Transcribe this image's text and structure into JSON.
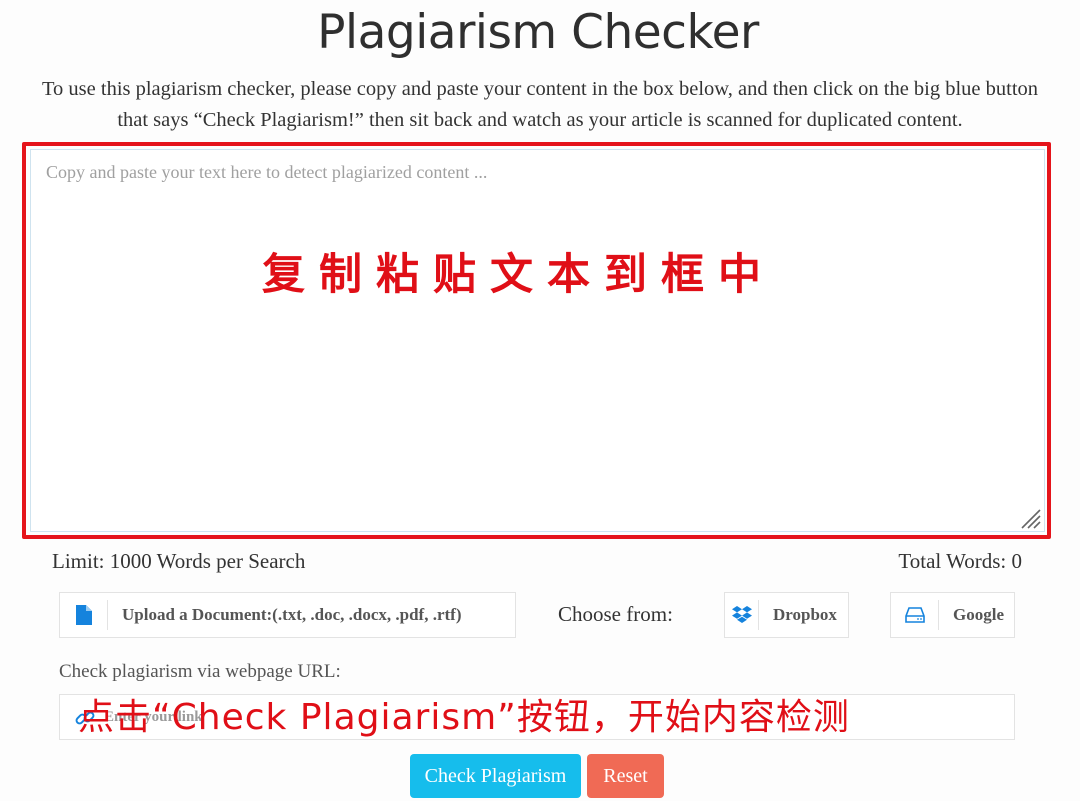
{
  "header": {
    "title": "Plagiarism Checker",
    "intro_line1": "To use this plagiarism checker, please copy and paste your content in the box below, and then click on the big blue button",
    "intro_line2": "that says “Check Plagiarism!” then sit back and watch as your article is scanned for duplicated content."
  },
  "editor": {
    "value": "",
    "placeholder": "Copy and paste your text here to detect plagiarized content ..."
  },
  "annotations": {
    "paste_hint": "复制粘贴文本到框中",
    "click_hint_prefix": "点击",
    "click_hint_button": "“Check Plagiarism”",
    "click_hint_suffix": "按钮，开始内容检测",
    "color": "#e00f17"
  },
  "stats": {
    "limit": "Limit: 1000 Words per Search",
    "total_words": "Total Words: 0"
  },
  "upload": {
    "upload_label": "Upload a Document:(.txt, .doc, .docx, .pdf, .rtf)",
    "upload_icon": "file-icon",
    "choose_from": "Choose from:",
    "dropbox_label": "Dropbox",
    "dropbox_icon": "dropbox-icon",
    "google_label": "Google",
    "google_icon": "drive-icon"
  },
  "url_check": {
    "label": "Check plagiarism via webpage URL:",
    "value": "",
    "placeholder": "Enter your link",
    "icon": "link-icon"
  },
  "actions": {
    "check_label": "Check Plagiarism",
    "reset_label": "Reset",
    "check_color": "#16bdec",
    "reset_color": "#f06a55"
  }
}
